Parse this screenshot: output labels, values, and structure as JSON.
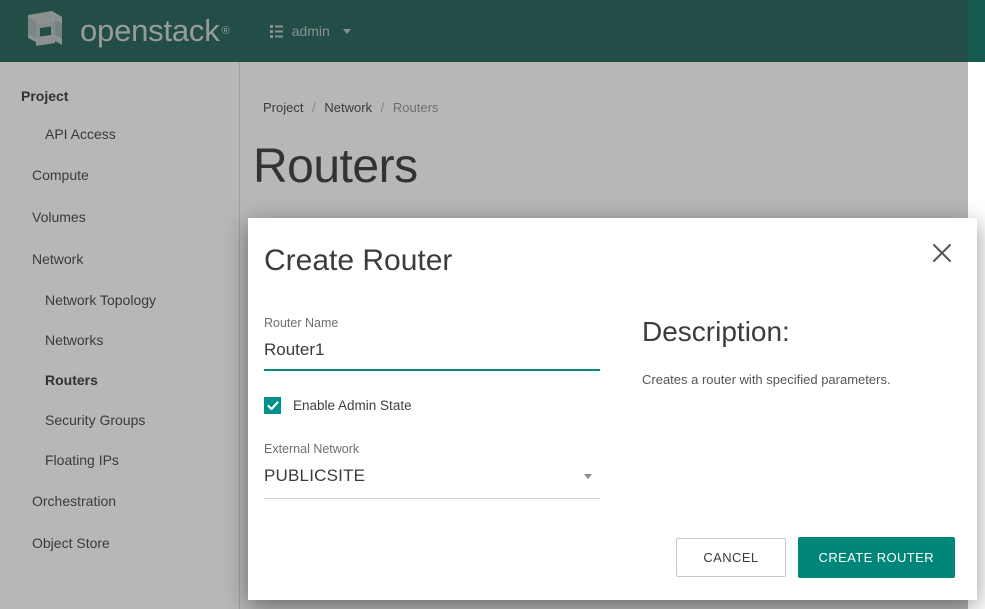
{
  "navbar": {
    "brand_name": "openstack",
    "brand_registered": "®",
    "logo_icon": "openstack-logo-icon",
    "grid_icon": "grid-list-icon",
    "project_label": "admin",
    "caret_icon": "chevron-down-icon",
    "background_color": "#16594f"
  },
  "sidebar": {
    "heading": "Project",
    "items": [
      {
        "label": "API Access",
        "level": "item",
        "active": false
      },
      {
        "label": "Compute",
        "level": "group",
        "active": false
      },
      {
        "label": "Volumes",
        "level": "group",
        "active": false
      },
      {
        "label": "Network",
        "level": "group",
        "active": false
      },
      {
        "label": "Network Topology",
        "level": "item",
        "active": false
      },
      {
        "label": "Networks",
        "level": "item",
        "active": false
      },
      {
        "label": "Routers",
        "level": "item",
        "active": true
      },
      {
        "label": "Security Groups",
        "level": "item",
        "active": false
      },
      {
        "label": "Floating IPs",
        "level": "item",
        "active": false
      },
      {
        "label": "Orchestration",
        "level": "group",
        "active": false
      },
      {
        "label": "Object Store",
        "level": "group",
        "active": false
      }
    ]
  },
  "breadcrumb": {
    "items": [
      "Project",
      "Network",
      "Routers"
    ],
    "separator": "/"
  },
  "page": {
    "title": "Routers"
  },
  "modal": {
    "title": "Create Router",
    "close_icon": "close-x-icon",
    "form": {
      "name_label": "Router Name",
      "name_value": "Router1",
      "name_placeholder": "Router Name",
      "checkbox_label": "Enable Admin State",
      "checkbox_checked": true,
      "check_icon": "checkmark-icon",
      "network_label": "External Network",
      "network_value": "PUBLICSITE",
      "network_caret_icon": "chevron-down-icon"
    },
    "description": {
      "title": "Description:",
      "text": "Creates a router with specified parameters."
    },
    "footer": {
      "cancel_label": "CANCEL",
      "submit_label": "CREATE ROUTER"
    }
  },
  "colors": {
    "header_teal": "#16594f",
    "accent_teal": "#008579",
    "checkbox_teal": "#009189",
    "focus_underline": "#00857f"
  }
}
